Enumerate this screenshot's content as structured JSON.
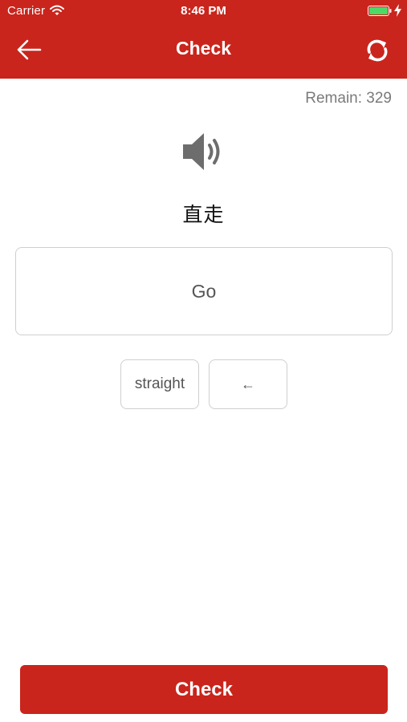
{
  "status_bar": {
    "carrier": "Carrier",
    "time": "8:46 PM"
  },
  "nav": {
    "back_icon": "arrow-left-icon",
    "title": "Check",
    "refresh_icon": "refresh-icon"
  },
  "remain_text": "Remain: 329",
  "audio_icon": "speaker-icon",
  "prompt": "直走",
  "answer": "Go",
  "word_bank": [
    {
      "label": "straight"
    },
    {
      "label": "←"
    }
  ],
  "check_button_label": "Check",
  "colors": {
    "primary": "#c9251c",
    "battery": "#4cd964",
    "text_gray": "#555555",
    "border": "#cfcfcf"
  }
}
